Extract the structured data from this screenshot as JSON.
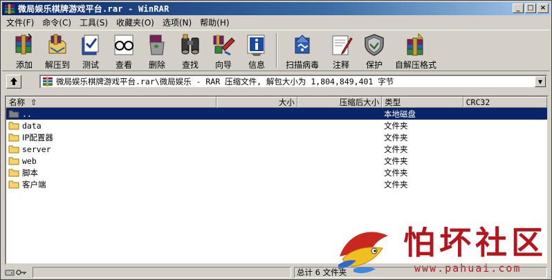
{
  "window": {
    "title": "微局娱乐棋牌游戏平台.rar - WinRAR",
    "controls": {
      "minimize": "_",
      "maximize": "□",
      "close": "×"
    }
  },
  "menubar": {
    "items": [
      "文件(F)",
      "命令(C)",
      "工具(S)",
      "收藏夹(O)",
      "选项(N)",
      "帮助(H)"
    ]
  },
  "toolbar": {
    "buttons": [
      {
        "label": "添加",
        "icon": "add-archive-icon"
      },
      {
        "label": "解压到",
        "icon": "extract-to-icon"
      },
      {
        "label": "测试",
        "icon": "test-icon"
      },
      {
        "label": "查看",
        "icon": "view-icon"
      },
      {
        "label": "删除",
        "icon": "delete-icon"
      },
      {
        "label": "查找",
        "icon": "find-icon"
      },
      {
        "label": "向导",
        "icon": "wizard-icon"
      },
      {
        "label": "信息",
        "icon": "info-icon"
      },
      {
        "label": "扫描病毒",
        "icon": "virus-scan-icon"
      },
      {
        "label": "注释",
        "icon": "comment-icon"
      },
      {
        "label": "保护",
        "icon": "protect-icon"
      },
      {
        "label": "自解压格式",
        "icon": "sfx-icon"
      }
    ]
  },
  "address": {
    "path": "微局娱乐棋牌游戏平台.rar\\微局娱乐 - RAR 压缩文件, 解包大小为 1,804,849,401 字节"
  },
  "columns": {
    "name": "名称",
    "size": "大小",
    "packed": "压缩后大小",
    "type": "类型",
    "crc": "CRC32"
  },
  "files": [
    {
      "name": "..",
      "type": "本地磁盘",
      "selected": true
    },
    {
      "name": "data",
      "type": "文件夹"
    },
    {
      "name": "IP配置器",
      "type": "文件夹"
    },
    {
      "name": "server",
      "type": "文件夹"
    },
    {
      "name": "web",
      "type": "文件夹"
    },
    {
      "name": "脚本",
      "type": "文件夹"
    },
    {
      "name": "客户端",
      "type": "文件夹"
    }
  ],
  "statusbar": {
    "left": "",
    "right": "总计 6 文件夹"
  },
  "watermark": {
    "brand": "怕坏社区",
    "url": "www.pahuai.com"
  },
  "colors": {
    "title_start": "#0a246a",
    "title_end": "#a6caf0",
    "selection": "#0a246a",
    "watermark": "#b3161c"
  }
}
